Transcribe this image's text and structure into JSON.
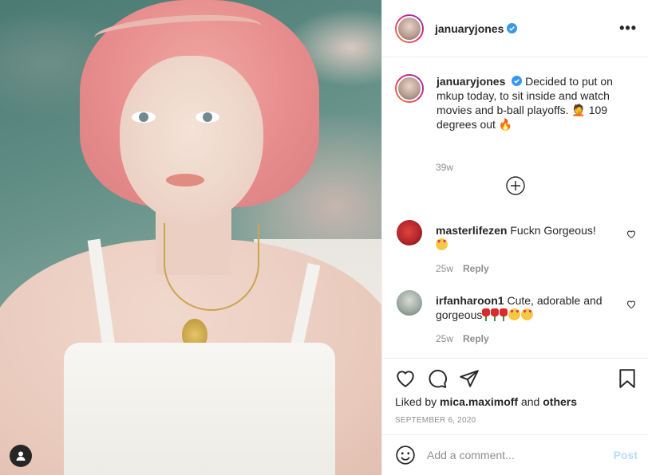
{
  "post": {
    "author": "januaryjones",
    "caption": "Decided to put on mkup today, to sit inside and watch movies and b-ball playoffs. 🤦 109 degrees out 🔥",
    "caption_time": "39w",
    "more_label": "•••"
  },
  "comments": [
    {
      "username": "masterlifezen",
      "text": "Fuckn Gorgeous!",
      "emojis": "😍",
      "time": "25w",
      "reply_label": "Reply",
      "avatar_color": "#b3272b"
    },
    {
      "username": "irfanharoon1",
      "text": "Cute, adorable and gorgeous",
      "emojis": "🌹🌹🌹😍😍",
      "time": "25w",
      "reply_label": "Reply",
      "avatar_color": "#7b8c86"
    }
  ],
  "footer": {
    "liked_prefix": "Liked by ",
    "liked_user": "mica.maximoff",
    "liked_and": " and ",
    "liked_others": "others",
    "date": "SEPTEMBER 6, 2020"
  },
  "add_comment": {
    "placeholder": "Add a comment...",
    "post_label": "Post"
  },
  "colors": {
    "verified": "#3897f0",
    "post_disabled": "#b2dffc",
    "muted": "#8e8e8e"
  },
  "icons": [
    "user-tag-icon",
    "verified-icon",
    "more-icon",
    "load-more-icon",
    "heart-icon",
    "comment-icon",
    "share-icon",
    "save-icon",
    "emoji-icon"
  ]
}
